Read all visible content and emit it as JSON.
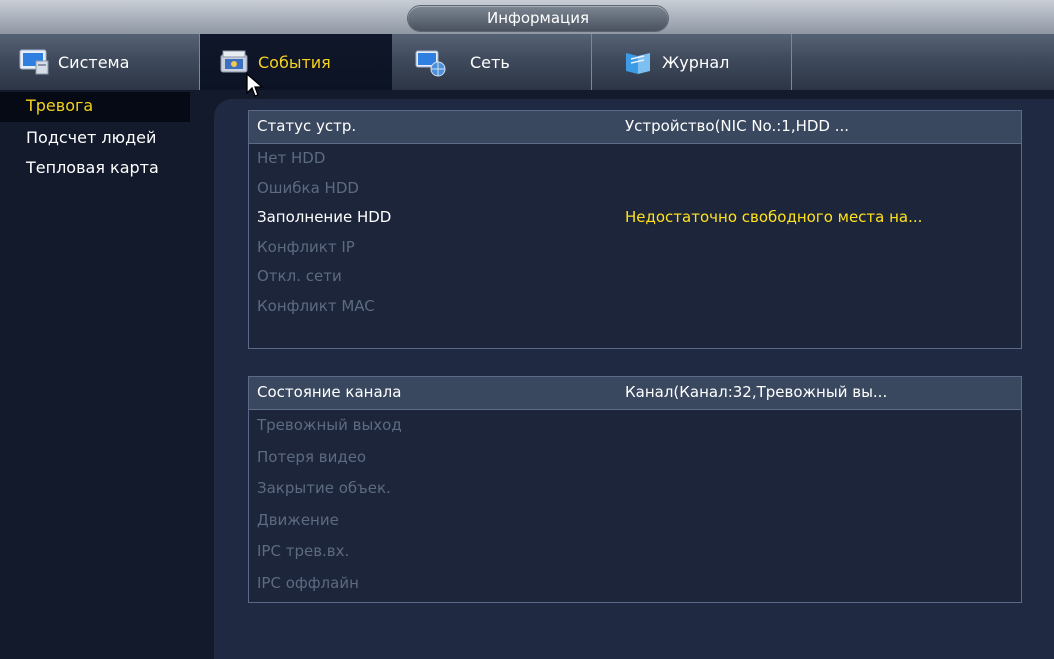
{
  "window": {
    "title": "Информация"
  },
  "tabs": [
    {
      "label": "Система",
      "icon": "system-monitor-icon",
      "active": false
    },
    {
      "label": "События",
      "icon": "events-icon",
      "active": true
    },
    {
      "label": "Сеть",
      "icon": "network-icon",
      "active": false
    },
    {
      "label": "Журнал",
      "icon": "log-icon",
      "active": false
    }
  ],
  "sidebar": {
    "items": [
      {
        "label": "Тревога",
        "active": true
      },
      {
        "label": "Подсчет людей",
        "active": false
      },
      {
        "label": "Тепловая карта",
        "active": false
      }
    ]
  },
  "device_status": {
    "header_col1": "Статус устр.",
    "header_col2": "Устройство(NIC No.:1,HDD ...",
    "rows": [
      {
        "name": "Нет HDD",
        "value": "",
        "state": "inactive"
      },
      {
        "name": "Ошибка HDD",
        "value": "",
        "state": "inactive"
      },
      {
        "name": "Заполнение HDD",
        "value": "Недостаточно свободного места на...",
        "state": "alarm"
      },
      {
        "name": "Конфликт IP",
        "value": "",
        "state": "inactive"
      },
      {
        "name": "Откл. сети",
        "value": "",
        "state": "inactive"
      },
      {
        "name": "Конфликт MAC",
        "value": "",
        "state": "inactive"
      }
    ]
  },
  "channel_status": {
    "header_col1": "Состояние канала",
    "header_col2": "Канал(Канал:32,Тревожный вы...",
    "rows": [
      {
        "name": "Тревожный выход",
        "state": "inactive"
      },
      {
        "name": "Потеря видео",
        "state": "inactive"
      },
      {
        "name": "Закрытие объек.",
        "state": "inactive"
      },
      {
        "name": "Движение",
        "state": "inactive"
      },
      {
        "name": "IPC трев.вх.",
        "state": "inactive"
      },
      {
        "name": "IPC оффлайн",
        "state": "inactive"
      }
    ]
  },
  "colors": {
    "accent_yellow": "#f5d21c",
    "alarm_text": "#ffe21f",
    "inactive_text": "#5c6a82",
    "background": "#131a2c"
  }
}
